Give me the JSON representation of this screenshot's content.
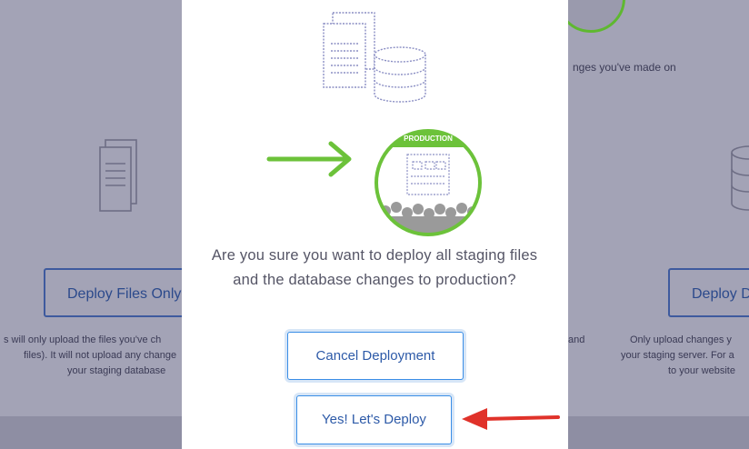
{
  "background": {
    "left_button_label": "Deploy Files Only",
    "left_description_lines": [
      "s will only upload the files you've ch",
      "files). It will not upload any change",
      "your staging database"
    ],
    "right_button_label": "Deploy D",
    "right_top_text": "nges you've made on",
    "right_description_lines": [
      "and",
      "Only upload changes y",
      "your staging server. For a",
      "to your website"
    ]
  },
  "modal": {
    "production_badge": "PRODUCTION",
    "question": "Are you sure you want to deploy all staging files and the database changes to production?",
    "cancel_label": "Cancel Deployment",
    "confirm_label": "Yes! Let's Deploy"
  },
  "colors": {
    "accent_blue": "#3a8ee6",
    "green": "#6cc23a",
    "red_arrow": "#e0322a",
    "overlay": "#a3a3b6"
  },
  "icons": [
    "documents-icon",
    "database-icon",
    "arrow-right-icon",
    "production-server-icon",
    "arrow-left-icon"
  ]
}
